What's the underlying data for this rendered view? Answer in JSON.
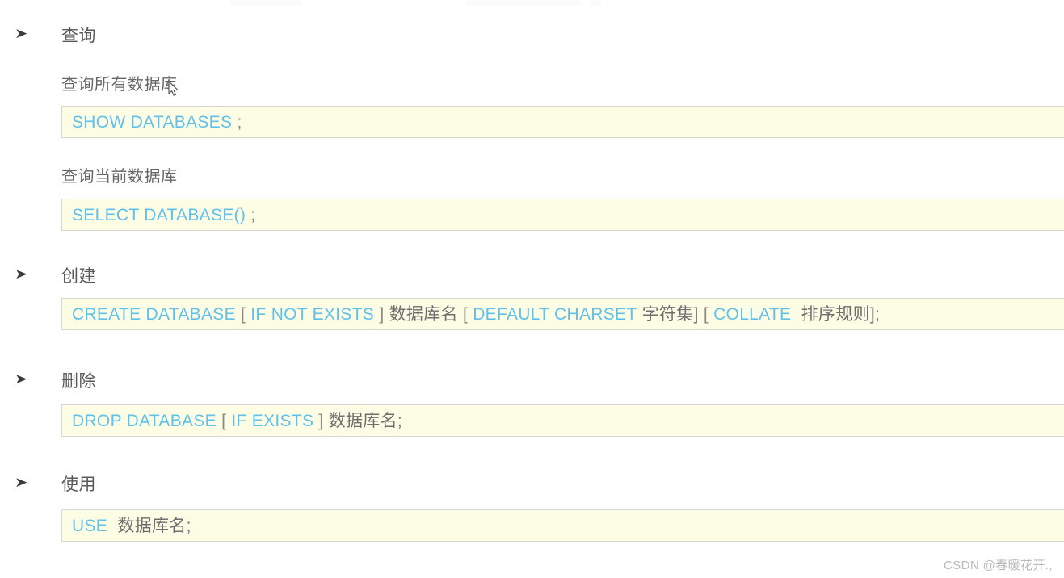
{
  "document": {
    "watermark": "CSDN @春暖花开.,",
    "bullet_glyph": "➤",
    "colors": {
      "code_background": "#fdfde6",
      "code_border": "#d7d7cc",
      "keyword": "#5fc0ec",
      "punctuation": "#8a8a85",
      "heading_text": "#595959",
      "page_background": "#ffffff",
      "watermark_text": "#b9b9b9"
    },
    "sections": [
      {
        "id": "query",
        "bullet_label": "查询",
        "subsections": [
          {
            "id": "query-all-databases",
            "heading": "查询所有数据库",
            "code": {
              "keyword": "SHOW DATABASES",
              "terminator": ";"
            }
          },
          {
            "id": "query-current-database",
            "heading": "查询当前数据库",
            "code": {
              "keyword": "SELECT DATABASE()",
              "terminator": ";"
            }
          }
        ]
      },
      {
        "id": "create",
        "bullet_label": "创建",
        "code": {
          "kw1": "CREATE DATABASE",
          "b1open": "[",
          "kw2": "IF NOT EXISTS",
          "b1close": "]",
          "plain1": "数据库名",
          "b2open": "[",
          "kw3": "DEFAULT CHARSET",
          "plain2": "字符集]",
          "b3open": "[",
          "kw4": "COLLATE",
          "plain3": "排序规则];"
        }
      },
      {
        "id": "drop",
        "bullet_label": "删除",
        "code": {
          "kw1": "DROP DATABASE",
          "b1open": "[",
          "kw2": "IF EXISTS",
          "b1close": "]",
          "plain1": "数据库名;"
        }
      },
      {
        "id": "use",
        "bullet_label": "使用",
        "code": {
          "kw1": "USE",
          "plain1": "数据库名;"
        }
      }
    ]
  }
}
